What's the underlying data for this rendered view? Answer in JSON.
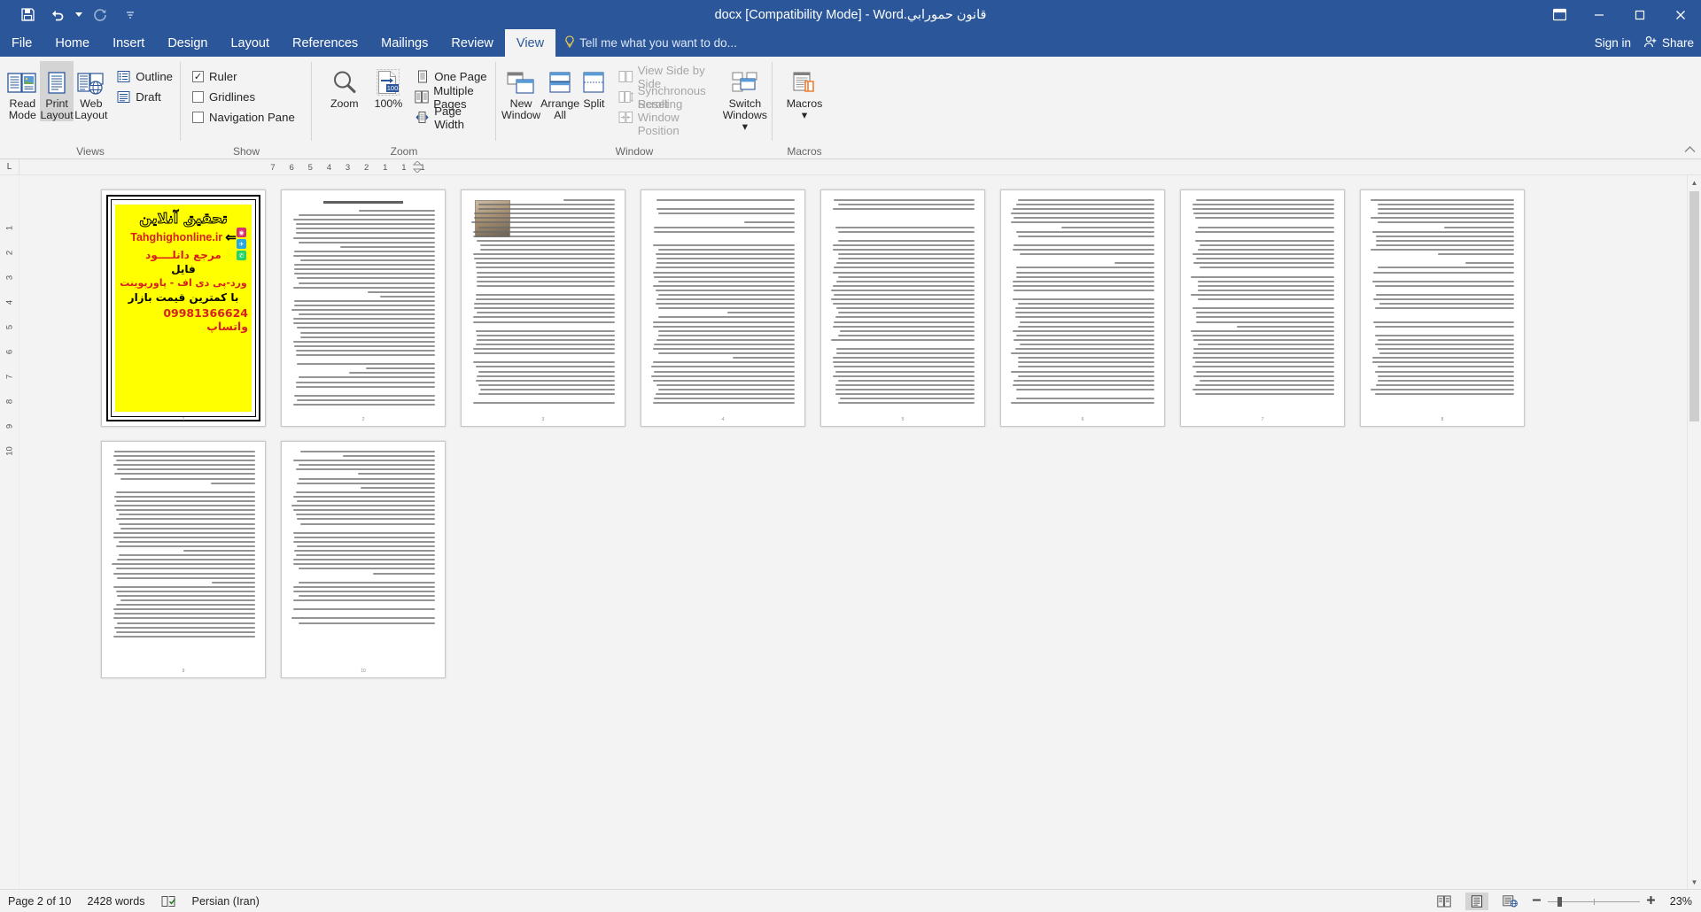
{
  "app": {
    "title": "قانون حمورابي.docx [Compatibility Mode] - Word",
    "accent": "#2b579a"
  },
  "quick_access": {
    "save": "Save",
    "undo": "Undo",
    "redo": "Redo",
    "customize": "Customize Quick Access Toolbar"
  },
  "window_controls": {
    "ribbon_display": "Ribbon Display Options",
    "minimize": "Minimize",
    "restore": "Restore Down",
    "close": "Close"
  },
  "tabs": [
    {
      "label": "File",
      "active": false
    },
    {
      "label": "Home",
      "active": false
    },
    {
      "label": "Insert",
      "active": false
    },
    {
      "label": "Design",
      "active": false
    },
    {
      "label": "Layout",
      "active": false
    },
    {
      "label": "References",
      "active": false
    },
    {
      "label": "Mailings",
      "active": false
    },
    {
      "label": "Review",
      "active": false
    },
    {
      "label": "View",
      "active": true
    }
  ],
  "tell_me": {
    "placeholder": "Tell me what you want to do..."
  },
  "account": {
    "sign_in": "Sign in",
    "share": "Share"
  },
  "ribbon": {
    "groups": [
      {
        "name": "Views",
        "label": "Views",
        "buttons": [
          {
            "id": "read-mode",
            "line1": "Read",
            "line2": "Mode",
            "selected": false
          },
          {
            "id": "print-layout",
            "line1": "Print",
            "line2": "Layout",
            "selected": true
          },
          {
            "id": "web-layout",
            "line1": "Web",
            "line2": "Layout",
            "selected": false
          }
        ],
        "items": [
          {
            "id": "outline",
            "label": "Outline"
          },
          {
            "id": "draft",
            "label": "Draft"
          }
        ]
      },
      {
        "name": "Show",
        "label": "Show",
        "checkboxes": [
          {
            "id": "ruler",
            "label": "Ruler",
            "checked": true
          },
          {
            "id": "gridlines",
            "label": "Gridlines",
            "checked": false
          },
          {
            "id": "navigation-pane",
            "label": "Navigation Pane",
            "checked": false
          }
        ]
      },
      {
        "name": "Zoom",
        "label": "Zoom",
        "buttons": [
          {
            "id": "zoom",
            "line1": "Zoom",
            "line2": ""
          },
          {
            "id": "zoom100",
            "line1": "100%",
            "line2": ""
          }
        ],
        "items": [
          {
            "id": "one-page",
            "label": "One Page"
          },
          {
            "id": "multiple-pages",
            "label": "Multiple Pages"
          },
          {
            "id": "page-width",
            "label": "Page Width"
          }
        ]
      },
      {
        "name": "Window",
        "label": "Window",
        "buttons": [
          {
            "id": "new-window",
            "line1": "New",
            "line2": "Window"
          },
          {
            "id": "arrange-all",
            "line1": "Arrange",
            "line2": "All"
          },
          {
            "id": "split",
            "line1": "Split",
            "line2": ""
          },
          {
            "id": "switch-windows",
            "line1": "Switch",
            "line2": "Windows ▾"
          }
        ],
        "items": [
          {
            "id": "view-side-by-side",
            "label": "View Side by Side",
            "disabled": true
          },
          {
            "id": "synchronous-scrolling",
            "label": "Synchronous Scrolling",
            "disabled": true
          },
          {
            "id": "reset-window-position",
            "label": "Reset Window Position",
            "disabled": true
          }
        ]
      },
      {
        "name": "Macros",
        "label": "Macros",
        "buttons": [
          {
            "id": "macros",
            "line1": "Macros",
            "line2": "▾"
          }
        ]
      }
    ]
  },
  "ruler": {
    "tab_stop_selector": "L",
    "numbers": [
      "7",
      "6",
      "5",
      "4",
      "3",
      "2",
      "1",
      "1",
      "1"
    ],
    "vertical_numbers": [
      "1",
      "2",
      "3",
      "4",
      "5",
      "6",
      "7",
      "8",
      "9",
      "10"
    ]
  },
  "document": {
    "ad_page": {
      "heading": "تحقیق آنلاین",
      "url": "Tahghighonline.ir",
      "line1": "مرجع دانلــــود",
      "line2": "فایل",
      "line3": "ورد-پی دی اف - پاورپوینت",
      "line4": "با کمترین قیمت بازار",
      "phone": "09981366624 واتساپ",
      "bg_color": "#ffff00",
      "accent_color": "#d81f1f"
    },
    "pages": [
      {
        "n": 1,
        "kind": "ad"
      },
      {
        "n": 2,
        "kind": "text",
        "title": true,
        "photo": false,
        "lines": 44
      },
      {
        "n": 3,
        "kind": "text",
        "title": false,
        "photo": true,
        "lines": 46
      },
      {
        "n": 4,
        "kind": "text",
        "title": false,
        "photo": false,
        "lines": 46
      },
      {
        "n": 5,
        "kind": "text",
        "title": false,
        "photo": false,
        "lines": 46
      },
      {
        "n": 6,
        "kind": "text",
        "title": false,
        "photo": false,
        "lines": 46
      },
      {
        "n": 7,
        "kind": "text",
        "title": false,
        "photo": false,
        "lines": 44
      },
      {
        "n": 8,
        "kind": "text",
        "title": false,
        "photo": false,
        "lines": 44
      },
      {
        "n": 9,
        "kind": "text",
        "title": false,
        "photo": false,
        "lines": 42
      },
      {
        "n": 10,
        "kind": "text",
        "title": false,
        "photo": false,
        "lines": 40
      }
    ]
  },
  "status_bar": {
    "page": "Page 2 of 10",
    "words": "2428 words",
    "proofing": "Proofing errors",
    "language": "Persian (Iran)",
    "views": [
      {
        "id": "read-mode-view",
        "label": "Read Mode",
        "selected": false
      },
      {
        "id": "print-layout-view",
        "label": "Print Layout",
        "selected": true
      },
      {
        "id": "web-layout-view",
        "label": "Web Layout",
        "selected": false
      }
    ],
    "zoom_out": "Zoom Out",
    "zoom_in": "Zoom In",
    "zoom_level": "23%"
  }
}
